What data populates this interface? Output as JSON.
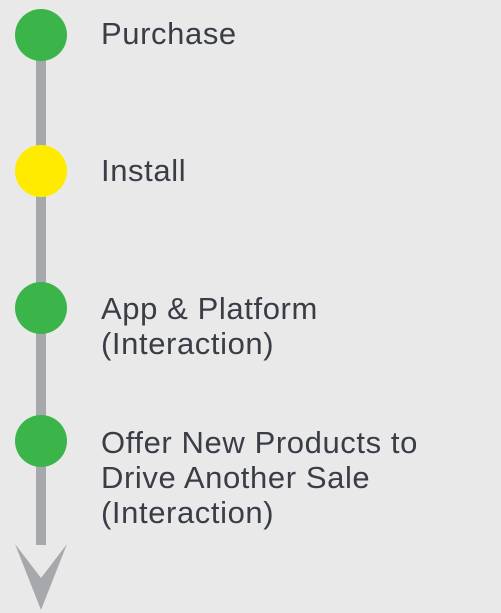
{
  "steps": [
    {
      "label": "Purchase",
      "color": "#3bb54a"
    },
    {
      "label": "Install",
      "color": "#ffeb00"
    },
    {
      "label": "App & Platform\n(Interaction)",
      "color": "#3bb54a"
    },
    {
      "label": "Offer New Products to\nDrive Another Sale\n(Interaction)",
      "color": "#3bb54a"
    }
  ],
  "line_color": "#a7a8ab"
}
